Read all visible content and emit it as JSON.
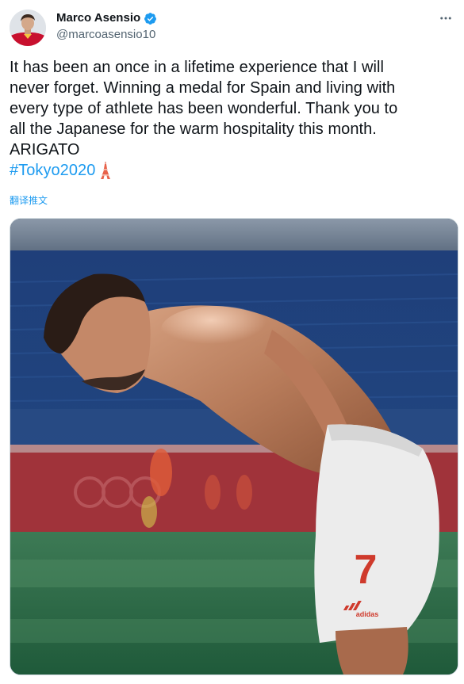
{
  "author": {
    "name": "Marco Asensio",
    "handle": "@marcoasensio10",
    "verified": true,
    "avatar_icon": "profile-avatar"
  },
  "tweet": {
    "lines": [
      "It has been an once in a lifetime experience that I will",
      "never forget. Winning a medal for Spain and living with",
      "every type of athlete has been wonderful. Thank you to",
      "all the Japanese for the warm hospitality this month.",
      "ARIGATO"
    ],
    "hashtag": "#Tokyo2020",
    "emoji_icon": "tokyo-tower-icon",
    "translate_label": "翻译推文"
  },
  "media": {
    "jersey_number": "7",
    "brand": "adidas"
  },
  "colors": {
    "link": "#1d9bf0",
    "text": "#0f1419",
    "muted": "#536471",
    "border": "#cfd9de"
  }
}
